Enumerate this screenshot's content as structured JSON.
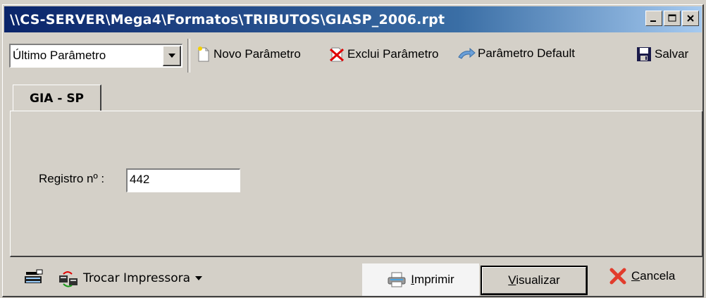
{
  "window": {
    "title": "\\\\CS-SERVER\\Mega4\\Formatos\\TRIBUTOS\\GIASP_2006.rpt",
    "buttons": {
      "minimize": "_",
      "maximize": "□",
      "close": "×"
    }
  },
  "toolbar": {
    "combo_value": "Último Parâmetro",
    "novo_label": "Novo Parâmetro",
    "exclui_label": "Exclui Parâmetro",
    "default_label": "Parâmetro Default",
    "salvar_label": "Salvar"
  },
  "tabs": [
    {
      "label": "GIA - SP"
    }
  ],
  "form": {
    "registro_label": "Registro nº :",
    "registro_value": "442"
  },
  "bottom": {
    "trocar_label": "Trocar Impressora",
    "imprimir_first": "I",
    "imprimir_rest": "mprimir",
    "visualizar_first": "V",
    "visualizar_rest": "isualizar",
    "cancela_first": "C",
    "cancela_rest": "ancela"
  },
  "colors": {
    "titlebar_start": "#0a246a",
    "titlebar_end": "#a6caf0",
    "face": "#d4d0c8",
    "cancel_x": "#e23c2c"
  }
}
